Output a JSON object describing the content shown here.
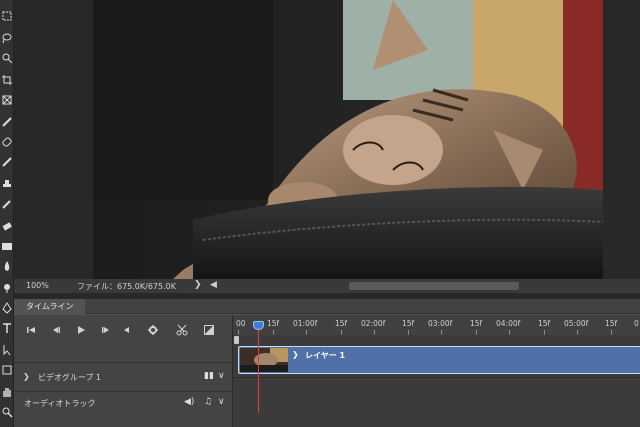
{
  "status": {
    "zoom": "100%",
    "file_info": "ファイル：675.0K/675.0K",
    "arrow": "❯",
    "scroll_left": "◀"
  },
  "timeline": {
    "tab_label": "タイムライン",
    "controls": {
      "first_frame": "first-frame-icon",
      "prev_frame": "prev-frame-icon",
      "play": "play-icon",
      "next_frame": "next-frame-icon",
      "audio": "speaker-icon",
      "settings": "gear-icon",
      "split": "scissors-icon",
      "transition": "transition-icon"
    },
    "ruler_labels": [
      "00",
      "15f",
      "01:00f",
      "15f",
      "02:00f",
      "15f",
      "03:00f",
      "15f",
      "04:00f",
      "15f",
      "05:00f",
      "15f",
      "0"
    ],
    "tracks": {
      "video_group": {
        "chevron": "❯",
        "name": "ビデオグループ 1",
        "icon_film": "▮▮",
        "icon_menu": "∨"
      },
      "audio": {
        "name": "オーディオトラック",
        "icon_speaker": "◀)",
        "icon_note": "♫",
        "icon_menu": "∨"
      }
    },
    "clip": {
      "chevron": "❯",
      "name": "レイヤー 1"
    }
  },
  "colors": {
    "clip_blue": "#5070a8",
    "playhead_red": "#e03a3a",
    "playhead_blue": "#3c7dd6"
  }
}
